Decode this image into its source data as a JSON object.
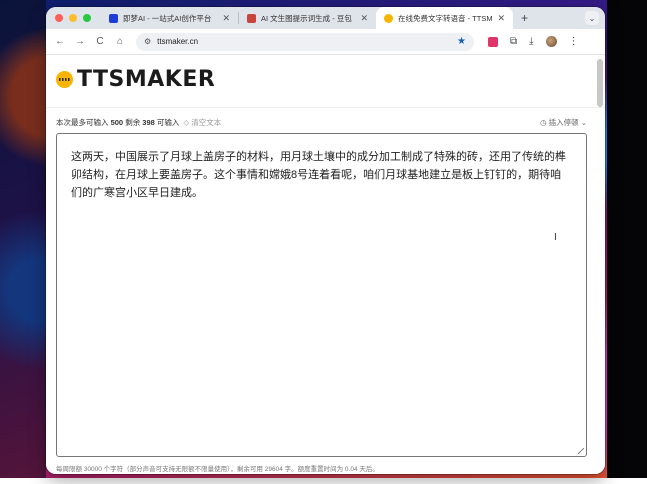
{
  "browser": {
    "tabs": [
      {
        "title": "即梦AI - 一站式AI创作平台",
        "favicon_color": "#1d3fd8",
        "active": false
      },
      {
        "title": "AI 文生图提示词生成 - 豆包",
        "favicon_color": "#c7453a",
        "active": false
      },
      {
        "title": "在线免费文字转语音 - TTSMaker",
        "favicon_color": "#f7b500",
        "active": true
      }
    ],
    "new_tab_label": "+",
    "tab_search_icon": "chevron-down-icon",
    "url": "ttsmaker.cn",
    "nav": {
      "back": "←",
      "forward": "→",
      "reload": "C",
      "home": "⌂"
    }
  },
  "page": {
    "logo_text": "TTSMAKER",
    "stats": {
      "prefix": "本次最多可输入",
      "max": "500",
      "remaining_label": "剩余",
      "remaining": "398",
      "suffix": "可输入",
      "clear_label": "清空文本"
    },
    "insert_pause_label": "插入停顿",
    "editor_text": "这两天，中国展示了月球上盖房子的材料，用月球土壤中的成分加工制成了特殊的砖，还用了传统的榫卯结构，在月球上要盖房子。这个事情和嫦娥8号连着看呢，咱们月球基地建立是板上钉钉的，期待咱们的广寒宫小区早日建成。",
    "footer_note": "每周限额 30000 个字符（部分声音可支持无限额不限量使用），剩余可用 29604 字。额度重置时间为 0.04 天后。"
  },
  "colors": {
    "brand_yellow": "#f7b500",
    "tab_strip": "#dfe3ea",
    "bookmark_star": "#1a5fb4"
  }
}
